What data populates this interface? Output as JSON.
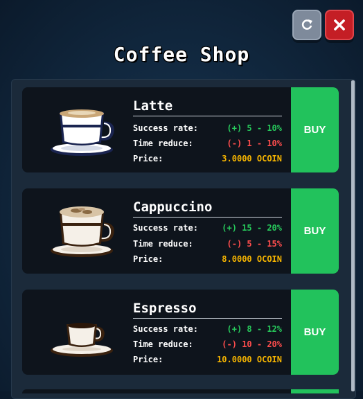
{
  "header": {
    "title": "Coffee Shop",
    "refresh_icon": "refresh-icon",
    "close_icon": "close-icon"
  },
  "labels": {
    "success": "Success rate:",
    "time": "Time reduce:",
    "price": "Price:",
    "buy": "BUY"
  },
  "items": [
    {
      "name": "Latte",
      "icon": "latte-cup-icon",
      "success": "(+) 5 - 10%",
      "time": "(-) 1 - 10%",
      "price": "3.0000 OCOIN"
    },
    {
      "name": "Cappuccino",
      "icon": "cappuccino-cup-icon",
      "success": "(+) 15 - 20%",
      "time": "(-) 5 - 15%",
      "price": "8.0000 OCOIN"
    },
    {
      "name": "Espresso",
      "icon": "espresso-cup-icon",
      "success": "(+) 8 - 12%",
      "time": "(-) 10 - 20%",
      "price": "10.0000 OCOIN"
    }
  ],
  "colors": {
    "buy": "#22c25c",
    "positive": "#27c95b",
    "negative": "#ff4d4d",
    "price": "#f5b400",
    "close": "#c41e25",
    "refresh": "#7e8a9b"
  }
}
